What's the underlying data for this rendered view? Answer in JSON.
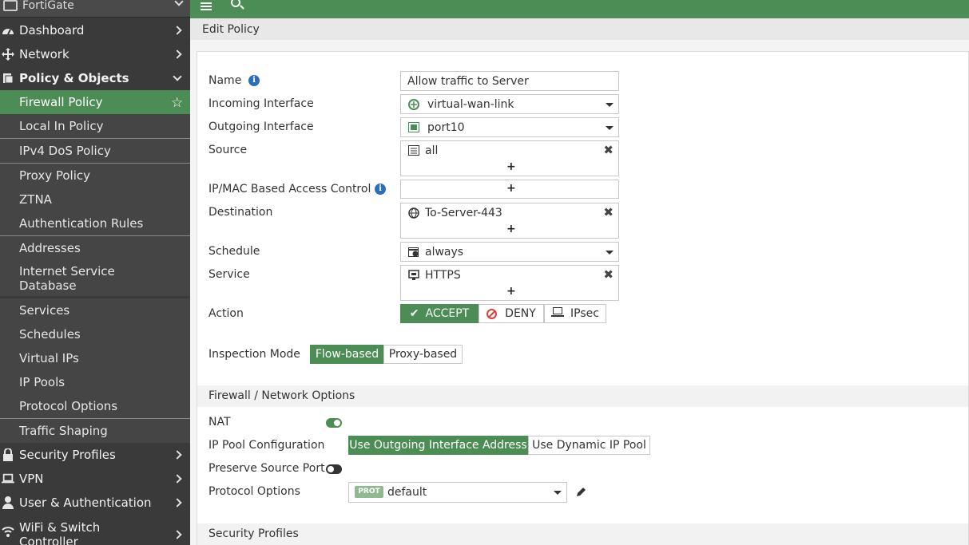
{
  "app": {
    "brand": "FortiGate",
    "page_title": "Edit Policy"
  },
  "sidebar": {
    "items": [
      {
        "label": "Dashboard"
      },
      {
        "label": "Network"
      },
      {
        "label": "Policy & Objects"
      },
      {
        "label": "Firewall Policy"
      },
      {
        "label": "Local In Policy"
      },
      {
        "label": "IPv4 DoS Policy"
      },
      {
        "label": "Proxy Policy"
      },
      {
        "label": "ZTNA"
      },
      {
        "label": "Authentication Rules"
      },
      {
        "label": "Addresses"
      },
      {
        "label": "Internet Service Database"
      },
      {
        "label": "Services"
      },
      {
        "label": "Schedules"
      },
      {
        "label": "Virtual IPs"
      },
      {
        "label": "IP Pools"
      },
      {
        "label": "Protocol Options"
      },
      {
        "label": "Traffic Shaping"
      },
      {
        "label": "Security Profiles"
      },
      {
        "label": "VPN"
      },
      {
        "label": "User & Authentication"
      },
      {
        "label": "WiFi & Switch Controller"
      }
    ]
  },
  "form": {
    "name": {
      "label": "Name",
      "value": "Allow traffic to Server"
    },
    "incoming_interface": {
      "label": "Incoming Interface",
      "value": "virtual-wan-link"
    },
    "outgoing_interface": {
      "label": "Outgoing Interface",
      "value": "port10"
    },
    "source": {
      "label": "Source",
      "value": "all"
    },
    "ipmac": {
      "label": "IP/MAC Based Access Control"
    },
    "destination": {
      "label": "Destination",
      "value": "To-Server-443"
    },
    "schedule": {
      "label": "Schedule",
      "value": "always"
    },
    "service": {
      "label": "Service",
      "value": "HTTPS"
    },
    "action": {
      "label": "Action",
      "accept": "ACCEPT",
      "deny": "DENY",
      "ipsec": "IPsec",
      "selected": "ACCEPT"
    },
    "inspection_mode": {
      "label": "Inspection Mode",
      "flow": "Flow-based",
      "proxy": "Proxy-based",
      "selected": "Flow-based"
    },
    "plus": "+",
    "remove": "✖"
  },
  "firewall_options": {
    "header": "Firewall / Network Options",
    "nat": {
      "label": "NAT",
      "enabled": true
    },
    "ip_pool": {
      "label": "IP Pool Configuration",
      "outgoing": "Use Outgoing Interface Address",
      "dynamic": "Use Dynamic IP Pool",
      "selected": "Use Outgoing Interface Address"
    },
    "preserve_source_port": {
      "label": "Preserve Source Port",
      "enabled": false
    },
    "protocol_options": {
      "label": "Protocol Options",
      "badge": "PROT",
      "value": "default"
    }
  },
  "security_profiles": {
    "header": "Security Profiles"
  },
  "colors": {
    "accent": "#4c8c55",
    "sidebar_bg": "#3a3a3a",
    "info_blue": "#2a6db8"
  }
}
